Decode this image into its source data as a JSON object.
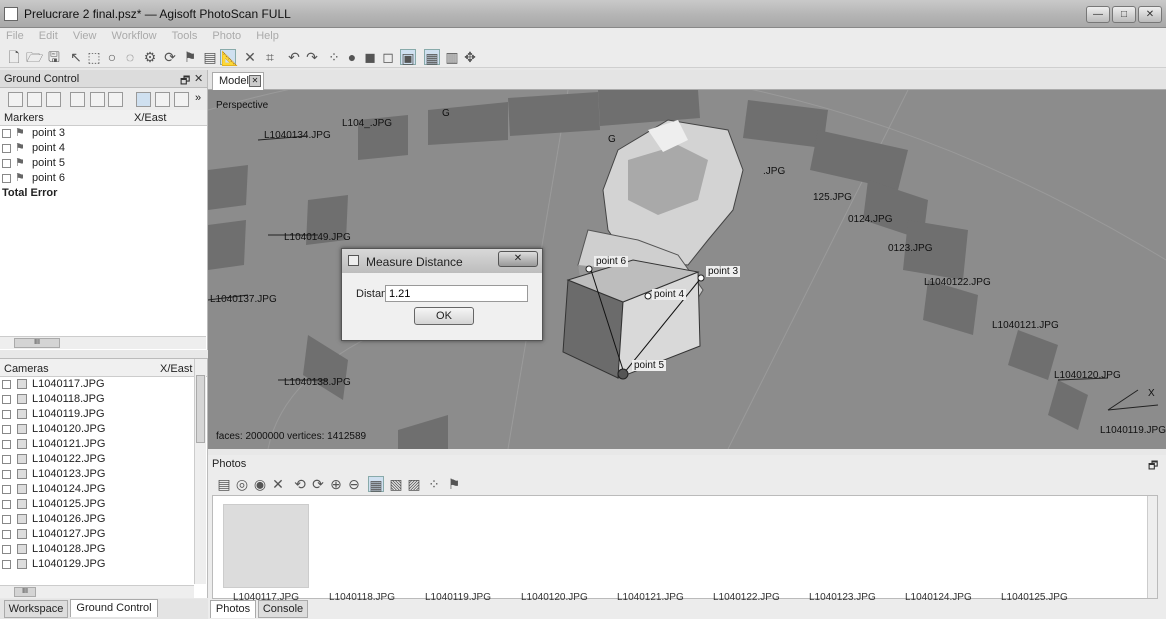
{
  "window": {
    "title": "Prelucrare 2 final.psz* — Agisoft PhotoScan  FULL",
    "minimize_label": "—",
    "maximize_label": "□",
    "close_label": "✕"
  },
  "menu": [
    "File",
    "Edit",
    "View",
    "Workflow",
    "Tools",
    "Photo",
    "Help"
  ],
  "ground_control": {
    "panel_title": "Ground Control",
    "float_label": "🗗",
    "close_label": "✕",
    "more_label": "»",
    "markers_header": "Markers",
    "xeast_header": "X/East",
    "markers": [
      "point 3",
      "point 4",
      "point 5",
      "point 6"
    ],
    "total_error": "Total Error",
    "scroll_mark": "III"
  },
  "cameras": {
    "header": "Cameras",
    "xeast_header": "X/East",
    "items": [
      "L1040117.JPG",
      "L1040118.JPG",
      "L1040119.JPG",
      "L1040120.JPG",
      "L1040121.JPG",
      "L1040122.JPG",
      "L1040123.JPG",
      "L1040124.JPG",
      "L1040125.JPG",
      "L1040126.JPG",
      "L1040127.JPG",
      "L1040128.JPG",
      "L1040129.JPG"
    ],
    "scroll_mark": "III"
  },
  "bottom_tabs": [
    "Workspace",
    "Ground Control"
  ],
  "model": {
    "tab_label": "Model",
    "tab_close": "✕",
    "perspective_label": "Perspective",
    "stats": "faces: 2000000 vertices: 1412589",
    "camera_labels": [
      "L1040134.JPG",
      "L104_.JPG",
      "L1040149.JPG",
      "L1040137.JPG",
      "L1040138.JPG",
      "125.JPG",
      "0124.JPG",
      "0123.JPG",
      "L1040122.JPG",
      "L1040121.JPG",
      "L1040120.JPG",
      "L1040119.JPG",
      ".JPG",
      "G",
      "G"
    ],
    "markers": [
      "point 6",
      "point 3",
      "point 4",
      "point 5"
    ],
    "axis_x": "X"
  },
  "dialog": {
    "title": "Measure Distance",
    "close_label": "✕",
    "distance_label": "Distance, m:",
    "distance_value": "1.21",
    "ok_label": "OK"
  },
  "photos": {
    "panel_title": "Photos",
    "float_label": "🗗",
    "thumbnails": [
      "L1040117.JPG",
      "L1040118.JPG",
      "L1040119.JPG",
      "L1040120.JPG",
      "L1040121.JPG",
      "L1040122.JPG",
      "L1040123.JPG",
      "L1040124.JPG",
      "L1040125.JPG"
    ]
  },
  "photos_tabs": [
    "Photos",
    "Console"
  ]
}
